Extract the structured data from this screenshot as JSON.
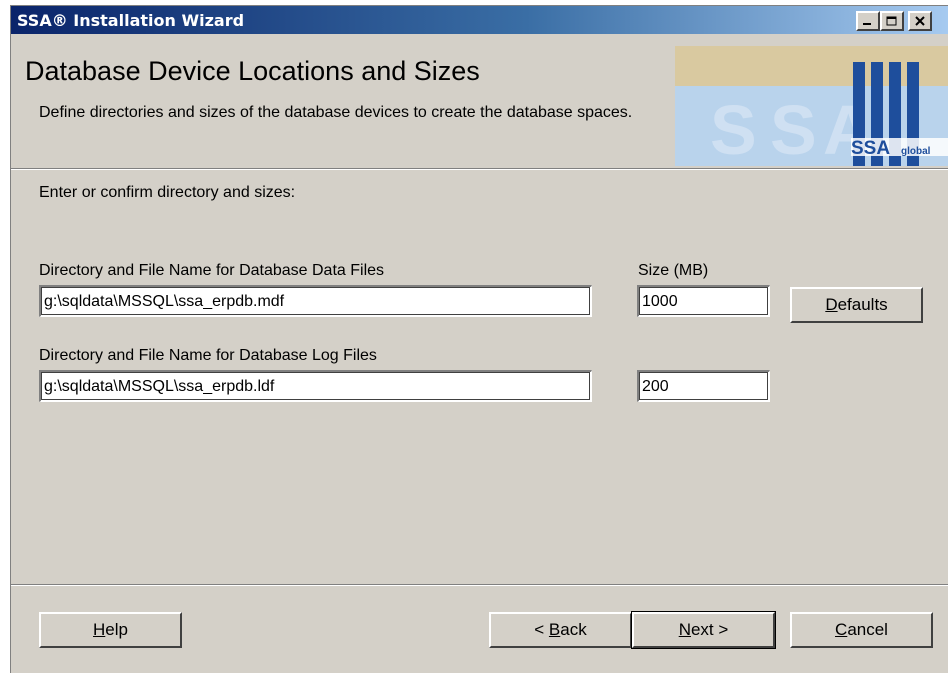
{
  "window": {
    "title": "SSA® Installation Wizard"
  },
  "header": {
    "title": "Database Device Locations and Sizes",
    "description": "Define directories and sizes of the database devices to create the database spaces.",
    "logo": {
      "text": "SSA",
      "subtext": "global"
    }
  },
  "body": {
    "instruction": "Enter or confirm directory and sizes:",
    "data_files": {
      "label": "Directory and File Name for Database Data Files",
      "value": "g:\\sqldata\\MSSQL\\ssa_erpdb.mdf",
      "size_label": "Size (MB)",
      "size_value": "1000"
    },
    "log_files": {
      "label": "Directory and File Name for Database Log Files",
      "value": "g:\\sqldata\\MSSQL\\ssa_erpdb.ldf",
      "size_value": "200"
    },
    "defaults_button": {
      "accel": "D",
      "rest": "efaults"
    }
  },
  "footer": {
    "help": {
      "accel": "H",
      "rest": "elp"
    },
    "back": {
      "pre": "< ",
      "accel": "B",
      "rest": "ack"
    },
    "next": {
      "accel": "N",
      "rest": "ext >"
    },
    "cancel": {
      "accel": "C",
      "rest": "ancel"
    }
  },
  "colors": {
    "face": "#d4d0c8",
    "title_start": "#0a246a",
    "title_end": "#a6caf0",
    "logo_blue": "#1e4e9c"
  },
  "icons": [
    "minimize-icon",
    "maximize-icon",
    "close-icon"
  ]
}
